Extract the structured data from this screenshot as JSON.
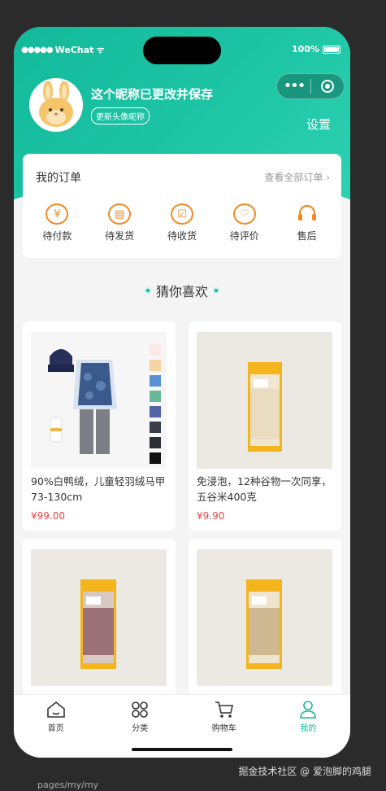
{
  "status_bar": {
    "carrier": "WeChat",
    "battery": "100%"
  },
  "profile": {
    "nickname": "这个昵称已更改并保存",
    "update_button": "更新头像昵称",
    "settings": "设置"
  },
  "orders": {
    "title": "我的订单",
    "view_all": "查看全部订单",
    "items": [
      {
        "label": "待付款",
        "icon": "yen-icon"
      },
      {
        "label": "待发货",
        "icon": "package-icon"
      },
      {
        "label": "待收货",
        "icon": "receive-icon"
      },
      {
        "label": "待评价",
        "icon": "heart-icon"
      },
      {
        "label": "售后",
        "icon": "headset-icon"
      }
    ]
  },
  "guess": {
    "title": "猜你喜欢"
  },
  "products": [
    {
      "name": "90%白鸭绒，儿童轻羽绒马甲73-130cm",
      "price": "¥99.00"
    },
    {
      "name": "免浸泡，12种谷物一次同享，五谷米400克",
      "price": "¥9.90"
    },
    {
      "name": "",
      "price": ""
    },
    {
      "name": "",
      "price": ""
    }
  ],
  "tabbar": {
    "items": [
      {
        "label": "首页",
        "icon": "home-icon",
        "active": false
      },
      {
        "label": "分类",
        "icon": "category-icon",
        "active": false
      },
      {
        "label": "购物车",
        "icon": "cart-icon",
        "active": false
      },
      {
        "label": "我的",
        "icon": "user-icon",
        "active": true
      }
    ]
  },
  "footer": {
    "watermark": "掘金技术社区 @ 爱泡脚的鸡腿",
    "path": "pages/my/my"
  },
  "colors": {
    "brand": "#16b897",
    "accent": "#f08a24",
    "price": "#e64545"
  }
}
